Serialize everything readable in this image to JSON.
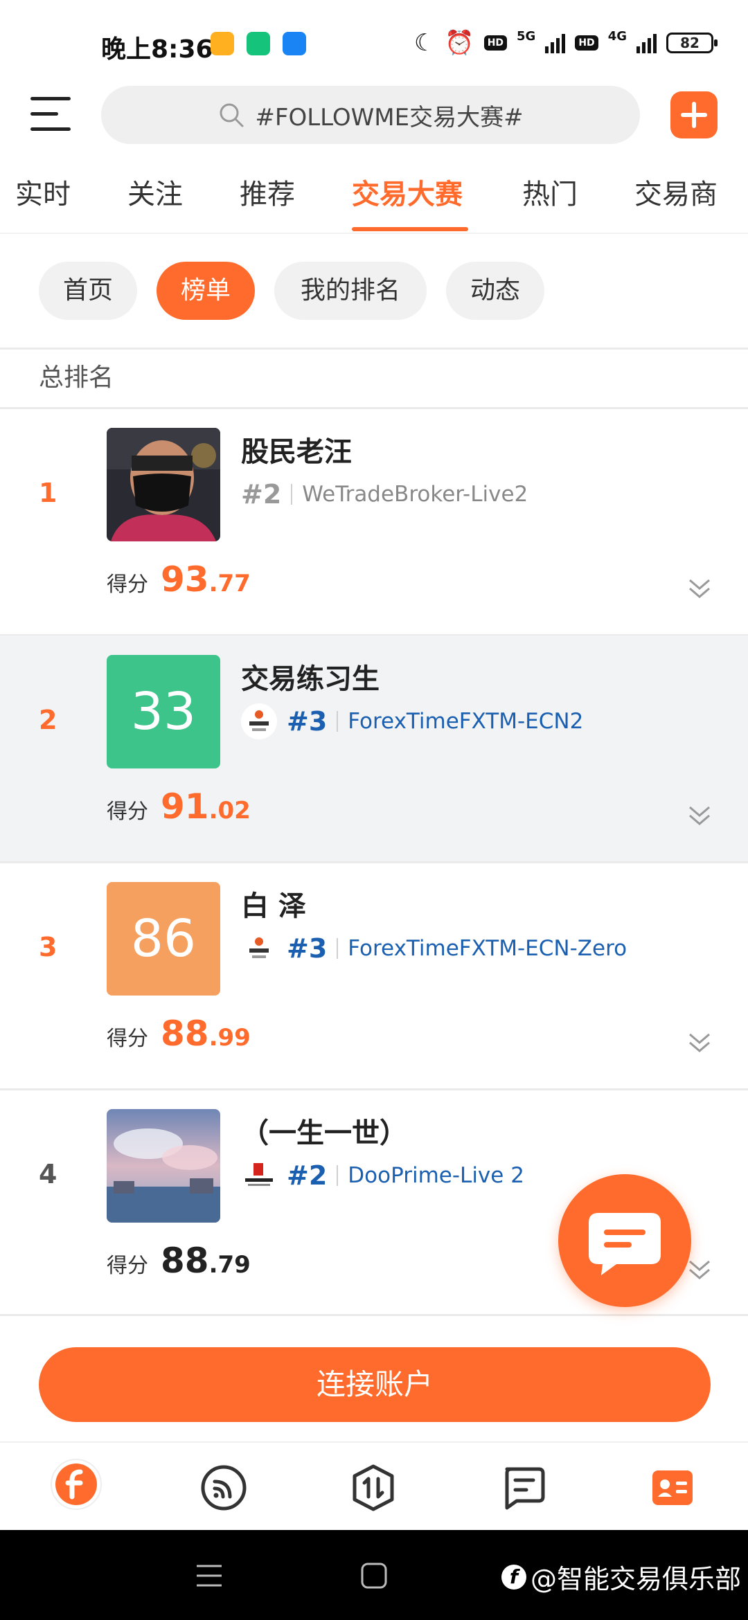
{
  "status_bar": {
    "time": "晚上8:36",
    "hd1": "HD",
    "net1": "5G",
    "hd2": "HD",
    "net2": "4G",
    "battery": "82"
  },
  "header": {
    "search_text": "#FOLLOWME交易大赛#"
  },
  "tabs": [
    {
      "label": "实时",
      "active": false
    },
    {
      "label": "关注",
      "active": false
    },
    {
      "label": "推荐",
      "active": false
    },
    {
      "label": "交易大赛",
      "active": true
    },
    {
      "label": "热门",
      "active": false
    },
    {
      "label": "交易商",
      "active": false
    }
  ],
  "sub_tabs": [
    {
      "label": "首页",
      "active": false
    },
    {
      "label": "榜单",
      "active": true
    },
    {
      "label": "我的排名",
      "active": false
    },
    {
      "label": "动态",
      "active": false
    }
  ],
  "section_title": "总排名",
  "rankings": [
    {
      "rank": "1",
      "name": "股民老汪",
      "avatar_text": "",
      "broker_rank": "#2",
      "broker": "WeTradeBroker-Live2",
      "score_label": "得分",
      "score_int": "93",
      "score_dec": ".77"
    },
    {
      "rank": "2",
      "name": "交易练习生",
      "avatar_text": "33",
      "broker_rank": "#3",
      "broker": "ForexTimeFXTM-ECN2",
      "score_label": "得分",
      "score_int": "91",
      "score_dec": ".02"
    },
    {
      "rank": "3",
      "name": "白 泽",
      "avatar_text": "86",
      "broker_rank": "#3",
      "broker": "ForexTimeFXTM-ECN-Zero",
      "score_label": "得分",
      "score_int": "88",
      "score_dec": ".99"
    },
    {
      "rank": "4",
      "name": "（一生一世）",
      "avatar_text": "",
      "broker_rank": "#2",
      "broker": "DooPrime-Live 2",
      "score_label": "得分",
      "score_int": "88",
      "score_dec": ".79"
    }
  ],
  "connect_button": "连接账户",
  "bottom_nav": [
    {
      "icon": "followme-logo-icon",
      "active": true
    },
    {
      "icon": "broadcast-icon",
      "active": false
    },
    {
      "icon": "trade-icon",
      "active": false
    },
    {
      "icon": "message-icon",
      "active": false
    },
    {
      "icon": "profile-card-icon",
      "active": false
    }
  ],
  "watermark": "@智能交易俱乐部",
  "colors": {
    "accent": "#ff6b2c",
    "broker_blue": "#1b5fb0",
    "avatar_green": "#3dc48a",
    "avatar_orange": "#f5a05f"
  }
}
